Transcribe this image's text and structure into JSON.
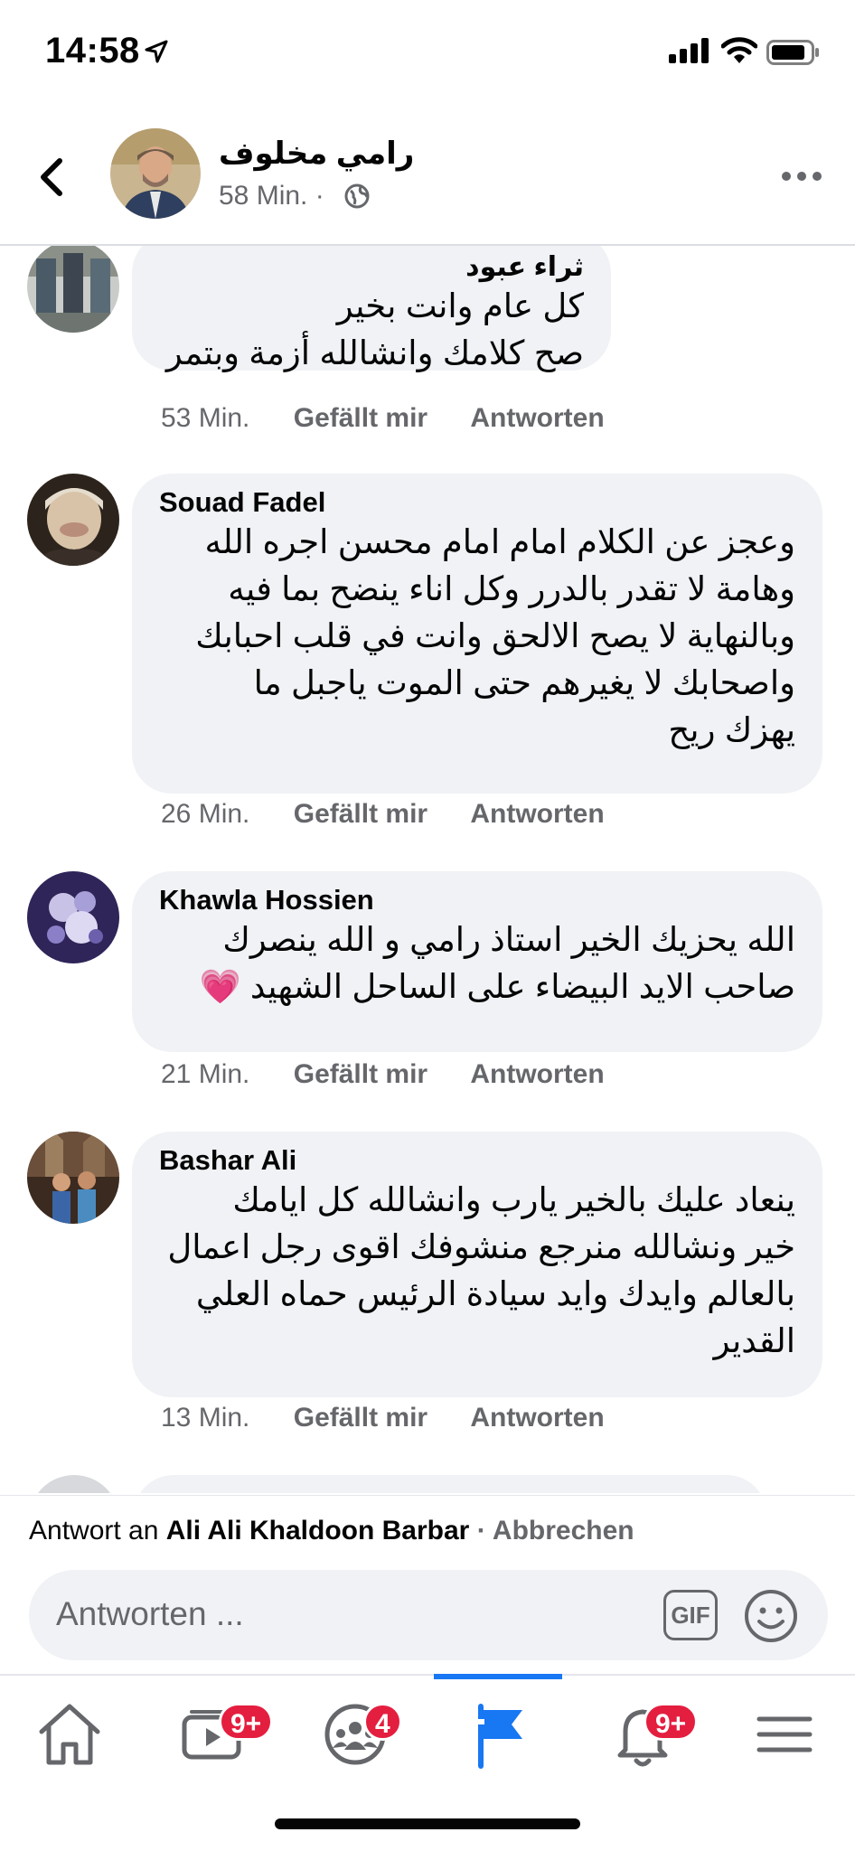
{
  "status_bar": {
    "time": "14:58"
  },
  "header": {
    "name": "رامي مخلوف",
    "time": "58 Min. ·"
  },
  "actions": {
    "like": "Gefällt mir",
    "reply": "Antworten"
  },
  "comments": [
    {
      "author": "ثراء عبود",
      "text": "كل عام وانت بخير\nصح كلامك وانشالله أزمة وبتمر",
      "time": "53 Min."
    },
    {
      "author": "Souad Fadel",
      "text": "وعجز عن الكلام امام امام محسن اجره الله\nوهامة لا تقدر بالدرر وكل اناء ينضح بما فيه\nوبالنهاية لا يصح الالحق وانت في قلب احبابك\nواصحابك لا يغيرهم حتى الموت ياجبل ما\nيهزك  ريح",
      "time": "26 Min."
    },
    {
      "author": "Khawla Hossien",
      "text": "الله يحزيك الخير استاذ رامي و الله ينصرك\nصاحب الايد البيضاء على الساحل الشهيد 💗",
      "time": "21 Min."
    },
    {
      "author": "Bashar Ali",
      "text": "ينعاد عليك بالخير يارب وانشالله كل ايامك\nخير ونشالله منرجع منشوفك اقوى رجل اعمال\nبالعالم وايدك وايد سيادة الرئيس حماه العلي\nالقدير",
      "time": "13 Min."
    }
  ],
  "composer": {
    "reply_prefix": "Antwort an",
    "reply_name": "Ali Ali Khaldoon Barbar",
    "cancel": "· Abbrechen",
    "placeholder": "Antworten ...",
    "gif": "GIF"
  },
  "tabbar": {
    "badges": {
      "watch": "9+",
      "groups": "4",
      "notifications": "9+"
    },
    "active_color": "#1877f2",
    "badge_color": "#e41e3f"
  }
}
